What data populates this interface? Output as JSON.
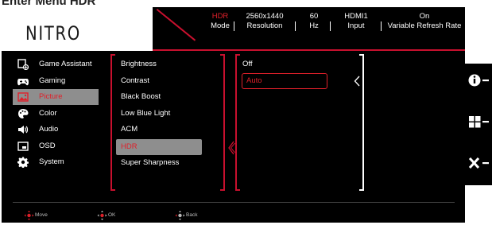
{
  "caption": "Enter Menu HDR",
  "logo": "NITRO",
  "status": [
    {
      "value": "HDR",
      "label": "Mode",
      "highlight": true
    },
    {
      "value": "2560x1440",
      "label": "Resolution",
      "highlight": false
    },
    {
      "value": "60",
      "label": "Hz",
      "highlight": false
    },
    {
      "value": "HDMI1",
      "label": "Input",
      "highlight": false
    },
    {
      "value": "On",
      "label": "Variable Refresh Rate",
      "highlight": false
    }
  ],
  "menu": {
    "items": [
      {
        "label": "Game Assistant",
        "icon": "game-assistant-icon"
      },
      {
        "label": "Gaming",
        "icon": "gamepad-icon"
      },
      {
        "label": "Picture",
        "icon": "picture-icon",
        "active": true
      },
      {
        "label": "Color",
        "icon": "palette-icon"
      },
      {
        "label": "Audio",
        "icon": "speaker-icon"
      },
      {
        "label": "OSD",
        "icon": "osd-icon"
      },
      {
        "label": "System",
        "icon": "gear-icon"
      }
    ]
  },
  "submenu": {
    "items": [
      {
        "label": "Brightness"
      },
      {
        "label": "Contrast"
      },
      {
        "label": "Black Boost"
      },
      {
        "label": "Low Blue Light"
      },
      {
        "label": "ACM"
      },
      {
        "label": "HDR",
        "active": true
      },
      {
        "label": "Super Sharpness"
      }
    ]
  },
  "options": {
    "items": [
      {
        "label": "Off"
      },
      {
        "label": "Auto",
        "selected": true
      }
    ]
  },
  "footer": {
    "move": "Move",
    "ok": "OK",
    "back": "Back"
  },
  "side": {
    "icons": [
      "info-icon",
      "menu-grid-icon",
      "close-icon"
    ]
  },
  "colors": {
    "accent": "#c8102e",
    "highlight_text": "#e0202a",
    "active_bg": "#8e8e8e",
    "background": "#000000"
  }
}
